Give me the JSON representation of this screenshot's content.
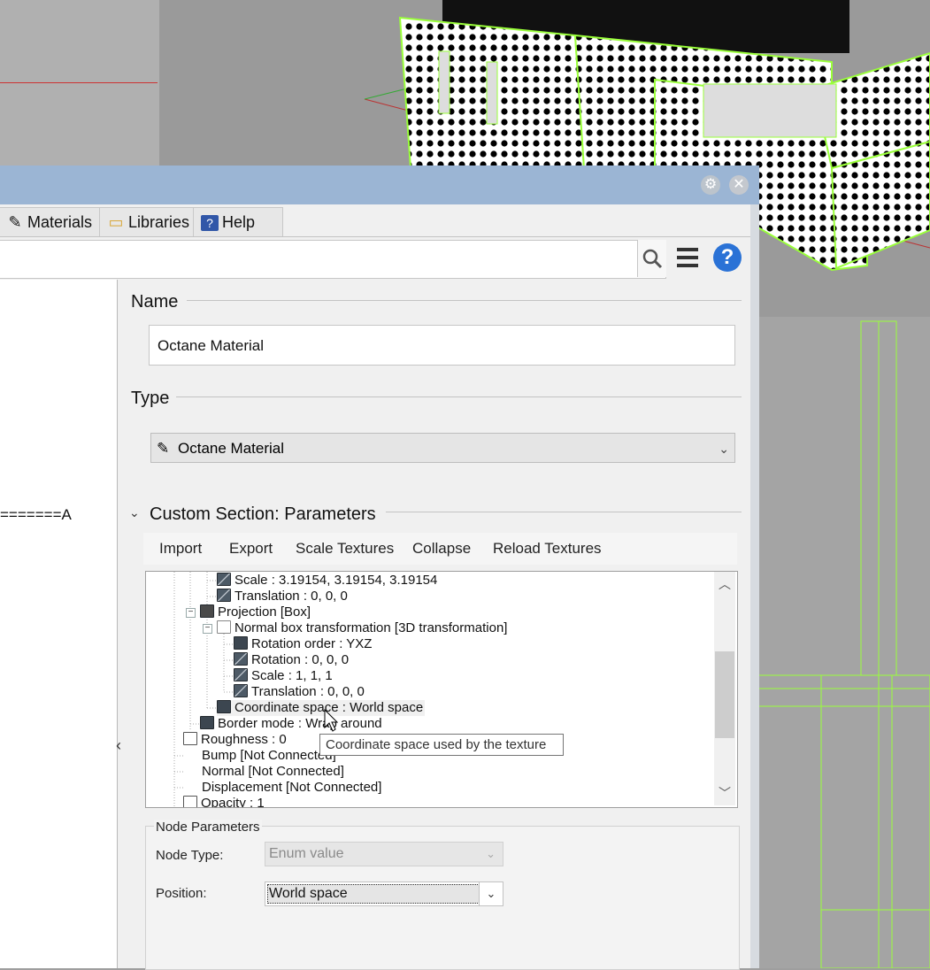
{
  "window": {
    "tabs": [
      {
        "label": "Materials",
        "icon": "dropper-icon"
      },
      {
        "label": "Libraries",
        "icon": "folder-icon"
      },
      {
        "label": "Help",
        "icon": "help-book-icon"
      }
    ]
  },
  "left_pane": {
    "marker_text": "=======A"
  },
  "name_section": {
    "heading": "Name",
    "value": "Octane Material"
  },
  "type_section": {
    "heading": "Type",
    "value": "Octane Material"
  },
  "custom_section": {
    "heading": "Custom Section: Parameters",
    "toolbar": [
      "Import",
      "Export",
      "Scale Textures",
      "Collapse",
      "Reload Textures"
    ]
  },
  "tree": {
    "rows": [
      {
        "text": "Scale : 3.19154, 3.19154, 3.19154"
      },
      {
        "text": "Translation : 0, 0, 0"
      },
      {
        "text": "Projection  [Box]"
      },
      {
        "text": "Normal box transformation  [3D transformation]"
      },
      {
        "text": "Rotation order : YXZ"
      },
      {
        "text": "Rotation : 0, 0, 0"
      },
      {
        "text": "Scale : 1, 1, 1"
      },
      {
        "text": "Translation : 0, 0, 0"
      },
      {
        "text": "Coordinate space : World space"
      },
      {
        "text": "Border mode : Wrap around"
      },
      {
        "text": "Roughness : 0"
      },
      {
        "text": "Bump  [Not Connected]"
      },
      {
        "text": "Normal  [Not Connected]"
      },
      {
        "text": "Displacement  [Not Connected]"
      },
      {
        "text": "Opacity : 1"
      }
    ],
    "tooltip": "Coordinate space used by the texture"
  },
  "node_params": {
    "legend": "Node Parameters",
    "node_type_label": "Node Type:",
    "node_type_value": "Enum value",
    "position_label": "Position:",
    "position_value": "World space"
  },
  "colors": {
    "titlebar": "#9bb5d4",
    "viewport_wireframe": "#9aff3a"
  }
}
